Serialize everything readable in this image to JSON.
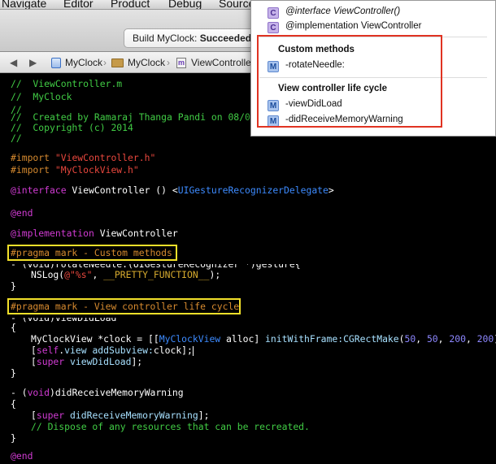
{
  "menubar": {
    "items": [
      "Navigate",
      "Editor",
      "Product",
      "Debug",
      "Source"
    ]
  },
  "toolbar": {
    "activity_prefix": "Build MyClock:",
    "activity_status": "Succeeded"
  },
  "jumpbar": {
    "back": "◀",
    "forward": "▶",
    "crumbs": [
      "MyClock",
      "MyClock",
      "ViewControlle"
    ]
  },
  "editor": {
    "comment_lines": [
      "//  ViewController.m",
      "//  MyClock",
      "//",
      "//  Created by Ramaraj Thanga Pandi on 08/07/",
      "//  Copyright (c) 2014",
      "//"
    ],
    "import_kw": "#import",
    "import1": "\"ViewController.h\"",
    "import2": "\"MyClockView.h\"",
    "iface_kw": "@interface",
    "iface_rest": " ViewController () <",
    "iface_proto": "UIGestureRecognizerDelegate",
    "iface_end": ">",
    "end_kw": "@end",
    "impl_kw": "@implementation",
    "impl_rest": " ViewController",
    "pragma1": "#pragma mark - Custom methods",
    "rotate_partial": "- (void)rotateNeedle:(UIGestureRecognizer *)gesture{",
    "nslog_fn": "NSLog",
    "nslog_open": "(",
    "nslog_str": "@\"%s\"",
    "nslog_mid": ", ",
    "nslog_macro": "__PRETTY_FUNCTION__",
    "nslog_close": ");",
    "brace_close": "}",
    "brace_open": "{",
    "pragma2": "#pragma mark - View controller life cycle",
    "viewdidload_partial": "- (void)viewDidLoad",
    "alloc_type": "MyClockView",
    "alloc_var": " *clock = [[",
    "alloc_type2": "MyClockView",
    "alloc_msg": " alloc] ",
    "alloc_init": "initWithFrame:",
    "alloc_rect": "CGRectMake",
    "alloc_open": "(",
    "n1": "50",
    "comma": ", ",
    "n2": "50",
    "n3": "200",
    "n4": "200",
    "alloc_close": ")];",
    "add_open": "[",
    "add_self": "self",
    "add_dot": ".",
    "add_view": "view",
    "add_msg": " addSubview:",
    "add_arg": "clock];",
    "super_open": "[",
    "super_kw": "super",
    "super_msg": " viewDidLoad",
    "super_close": "];",
    "warn_sig_pre": "- (",
    "warn_void": "void",
    "warn_sig": ")didReceiveMemoryWarning",
    "warn_super_msg": " didReceiveMemoryWarning",
    "dispose_comment": "// Dispose of any resources that can be recreated."
  },
  "popup": {
    "interface_item": "@interface ViewController()",
    "implementation_item": "@implementation ViewController",
    "section1_title": "Custom methods",
    "method_rotate": "-rotateNeedle:",
    "section2_title": "View controller life cycle",
    "method_viewdidload": "-viewDidLoad",
    "method_memwarning": "-didReceiveMemoryWarning",
    "badge_c": "C",
    "badge_m": "M"
  },
  "colors": {
    "comment": "#41cc45",
    "preprocessor": "#d68a2f",
    "string": "#e8473d",
    "keyword": "#d13bd3",
    "project_type": "#3d8bff",
    "number": "#8d87ff",
    "highlight_yellow": "#f2e02a",
    "highlight_red": "#e03322"
  }
}
